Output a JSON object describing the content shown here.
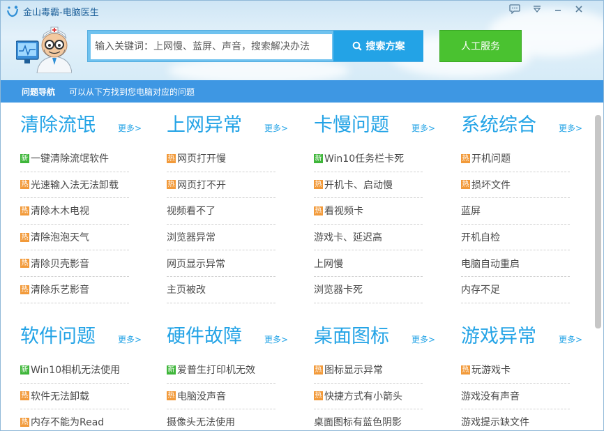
{
  "window": {
    "title": "金山毒霸-电脑医生",
    "accent": "#23a3e6"
  },
  "search": {
    "placeholder": "输入关键词：上网慢、蓝屏、声音，搜索解决办法",
    "button_label": "搜索方案"
  },
  "service_button": "人工服务",
  "nav": {
    "title": "问题导航",
    "description": "可以从下方找到您电脑对应的问题"
  },
  "more_label": "更多>",
  "badges": {
    "new": "新",
    "hot": "热"
  },
  "categories": [
    {
      "title": "清除流氓",
      "items": [
        {
          "label": "一键清除流氓软件",
          "badge": "new"
        },
        {
          "label": "光速输入法无法卸载",
          "badge": "hot"
        },
        {
          "label": "清除木木电视",
          "badge": "hot"
        },
        {
          "label": "清除泡泡天气",
          "badge": "hot"
        },
        {
          "label": "清除贝壳影音",
          "badge": "hot"
        },
        {
          "label": "清除乐艺影音",
          "badge": "hot"
        }
      ]
    },
    {
      "title": "上网异常",
      "items": [
        {
          "label": "网页打开慢",
          "badge": "hot"
        },
        {
          "label": "网页打不开",
          "badge": "hot"
        },
        {
          "label": "视频看不了",
          "badge": ""
        },
        {
          "label": "浏览器异常",
          "badge": ""
        },
        {
          "label": "网页显示异常",
          "badge": ""
        },
        {
          "label": "主页被改",
          "badge": ""
        }
      ]
    },
    {
      "title": "卡慢问题",
      "items": [
        {
          "label": "Win10任务栏卡死",
          "badge": "new"
        },
        {
          "label": "开机卡、启动慢",
          "badge": "hot"
        },
        {
          "label": "看视频卡",
          "badge": "hot"
        },
        {
          "label": "游戏卡、延迟高",
          "badge": ""
        },
        {
          "label": "上网慢",
          "badge": ""
        },
        {
          "label": "浏览器卡死",
          "badge": ""
        }
      ]
    },
    {
      "title": "系统综合",
      "items": [
        {
          "label": "开机问题",
          "badge": "hot"
        },
        {
          "label": "损坏文件",
          "badge": "hot"
        },
        {
          "label": "蓝屏",
          "badge": ""
        },
        {
          "label": "开机自检",
          "badge": ""
        },
        {
          "label": "电脑自动重启",
          "badge": ""
        },
        {
          "label": "内存不足",
          "badge": ""
        }
      ]
    },
    {
      "title": "软件问题",
      "items": [
        {
          "label": "Win10相机无法使用",
          "badge": "new"
        },
        {
          "label": "软件无法卸载",
          "badge": "hot"
        },
        {
          "label": "内存不能为Read",
          "badge": "hot"
        }
      ]
    },
    {
      "title": "硬件故障",
      "items": [
        {
          "label": "爱普生打印机无效",
          "badge": "new"
        },
        {
          "label": "电脑没声音",
          "badge": "hot"
        },
        {
          "label": "摄像头无法使用",
          "badge": ""
        }
      ]
    },
    {
      "title": "桌面图标",
      "items": [
        {
          "label": "图标显示异常",
          "badge": "hot"
        },
        {
          "label": "快捷方式有小箭头",
          "badge": "hot"
        },
        {
          "label": "桌面图标有蓝色阴影",
          "badge": ""
        }
      ]
    },
    {
      "title": "游戏异常",
      "items": [
        {
          "label": "玩游戏卡",
          "badge": "hot"
        },
        {
          "label": "游戏没有声音",
          "badge": ""
        },
        {
          "label": "游戏提示缺文件",
          "badge": ""
        }
      ]
    }
  ]
}
